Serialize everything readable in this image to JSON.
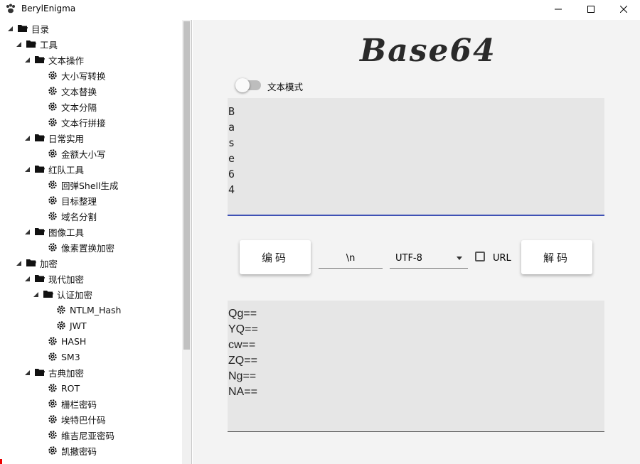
{
  "window": {
    "title": "BerylEnigma"
  },
  "tree": [
    {
      "label": "目录",
      "level": 0,
      "type": "folder"
    },
    {
      "label": "工具",
      "level": 1,
      "type": "folder"
    },
    {
      "label": "文本操作",
      "level": 2,
      "type": "folder"
    },
    {
      "label": "大小写转换",
      "level": 3,
      "type": "leaf"
    },
    {
      "label": "文本替换",
      "level": 3,
      "type": "leaf"
    },
    {
      "label": "文本分隔",
      "level": 3,
      "type": "leaf"
    },
    {
      "label": "文本行拼接",
      "level": 3,
      "type": "leaf"
    },
    {
      "label": "日常实用",
      "level": 2,
      "type": "folder"
    },
    {
      "label": "金额大小写",
      "level": 3,
      "type": "leaf"
    },
    {
      "label": "红队工具",
      "level": 2,
      "type": "folder"
    },
    {
      "label": "回弹Shell生成",
      "level": 3,
      "type": "leaf"
    },
    {
      "label": "目标整理",
      "level": 3,
      "type": "leaf"
    },
    {
      "label": "域名分割",
      "level": 3,
      "type": "leaf"
    },
    {
      "label": "图像工具",
      "level": 2,
      "type": "folder"
    },
    {
      "label": "像素置换加密",
      "level": 3,
      "type": "leaf"
    },
    {
      "label": "加密",
      "level": 1,
      "type": "folder"
    },
    {
      "label": "现代加密",
      "level": 2,
      "type": "folder"
    },
    {
      "label": "认证加密",
      "level": 3,
      "type": "folder"
    },
    {
      "label": "NTLM_Hash",
      "level": 4,
      "type": "leaf"
    },
    {
      "label": "JWT",
      "level": 4,
      "type": "leaf"
    },
    {
      "label": "HASH",
      "level": 3,
      "type": "leaf"
    },
    {
      "label": "SM3",
      "level": 3,
      "type": "leaf"
    },
    {
      "label": "古典加密",
      "level": 2,
      "type": "folder"
    },
    {
      "label": "ROT",
      "level": 3,
      "type": "leaf"
    },
    {
      "label": "栅栏密码",
      "level": 3,
      "type": "leaf"
    },
    {
      "label": "埃特巴什码",
      "level": 3,
      "type": "leaf"
    },
    {
      "label": "维吉尼亚密码",
      "level": 3,
      "type": "leaf"
    },
    {
      "label": "凯撒密码",
      "level": 3,
      "type": "leaf"
    }
  ],
  "main": {
    "logo": "Base64",
    "mode_toggle": {
      "label": "文本模式",
      "on": false
    },
    "input_text": "B\na\ns\ne\n6\n4",
    "encode_label": "编码",
    "separator_value": "\\n",
    "charset_value": "UTF-8",
    "url_label": "URL",
    "url_checked": false,
    "decode_label": "解码",
    "output_text": "Qg==\nYQ==\ncw==\nZQ==\nNg==\nNA=="
  },
  "colors": {
    "accent": "#3f51b5",
    "panel": "#f3f3f3",
    "field": "#e6e6e6"
  }
}
